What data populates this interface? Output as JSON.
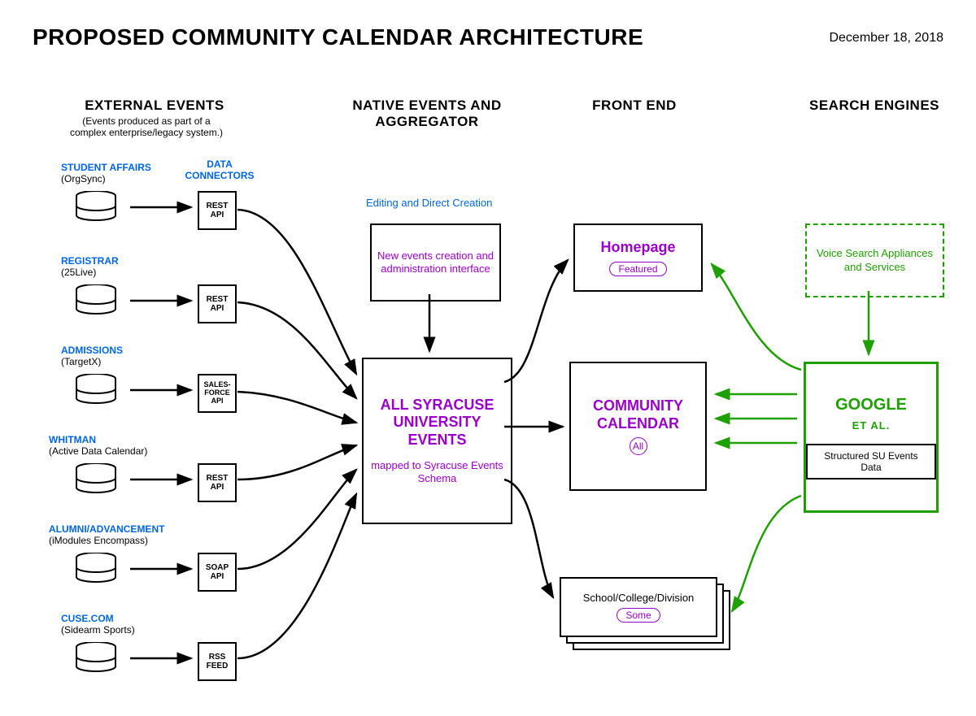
{
  "title": "PROPOSED COMMUNITY CALENDAR ARCHITECTURE",
  "date": "December 18, 2018",
  "columns": {
    "external": {
      "heading": "EXTERNAL EVENTS",
      "sub": "(Events produced as part of a complex enterprise/legacy system.)"
    },
    "native": {
      "heading": "NATIVE EVENTS AND AGGREGATOR"
    },
    "frontend": {
      "heading": "FRONT END"
    },
    "search": {
      "heading": "SEARCH  ENGINES"
    }
  },
  "dataConnectorsLabel": "DATA CONNECTORS",
  "sources": [
    {
      "name": "STUDENT AFFAIRS",
      "sub": "(OrgSync)",
      "connector": "REST API"
    },
    {
      "name": "REGISTRAR",
      "sub": "(25Live)",
      "connector": "REST API"
    },
    {
      "name": "ADMISSIONS",
      "sub": "(TargetX)",
      "connector": "SALES-FORCE API"
    },
    {
      "name": "WHITMAN",
      "sub": "(Active Data Calendar)",
      "connector": "REST API"
    },
    {
      "name": "ALUMNI/ADVANCEMENT",
      "sub": "(iModules Encompass)",
      "connector": "SOAP API"
    },
    {
      "name": "CUSE.COM",
      "sub": "(Sidearm Sports)",
      "connector": "RSS FEED"
    }
  ],
  "native": {
    "editingLabel": "Editing and Direct Creation",
    "adminBox": "New events creation and administration interface",
    "aggTitle": "ALL SYRACUSE UNIVERSITY EVENTS",
    "aggSub": "mapped to Syracuse Events Schema"
  },
  "frontend": {
    "homepage": {
      "title": "Homepage",
      "badge": "Featured"
    },
    "community": {
      "title": "COMMUNITY CALENDAR",
      "badge": "All"
    },
    "divisions": {
      "title": "School/College/Division",
      "badge": "Some"
    }
  },
  "search": {
    "voice": "Voice Search Appliances and Services",
    "google": {
      "title": "GOOGLE",
      "sub": "ET AL.",
      "inner": "Structured SU Events Data"
    }
  }
}
